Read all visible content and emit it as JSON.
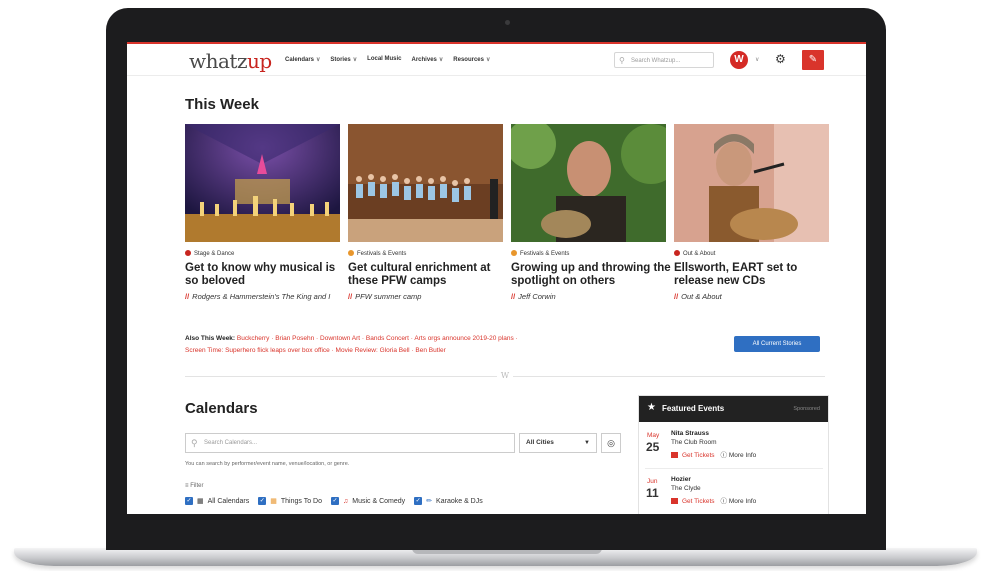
{
  "nav": {
    "logo_main": "whatz",
    "logo_accent": "up",
    "menu": [
      "Calendars",
      "Stories",
      "Local Music",
      "Archives",
      "Resources"
    ],
    "menu_has_chevron": [
      true,
      true,
      false,
      true,
      true
    ],
    "search_placeholder": "Search Whatzup...",
    "avatar_letter": "W"
  },
  "this_week": {
    "title": "This Week",
    "cards": [
      {
        "category": "Stage & Dance",
        "category_color": "#c8251f",
        "headline": "Get to know why musical is so beloved",
        "sub": "Rodgers & Hammerstein's The King and I"
      },
      {
        "category": "Festivals & Events",
        "category_color": "#e8962c",
        "headline": "Get cultural enrichment at these PFW camps",
        "sub": "PFW summer camp"
      },
      {
        "category": "Festivals & Events",
        "category_color": "#e8962c",
        "headline": "Growing up and throwing the spotlight on others",
        "sub": "Jeff Corwin"
      },
      {
        "category": "Out & About",
        "category_color": "#c8251f",
        "headline": "Ellsworth, EART set to release new CDs",
        "sub": "Out & About"
      }
    ],
    "also_label": "Also This Week:",
    "also_links": [
      "Buckcherry",
      "Brian Posehn",
      "Downtown Art",
      "Bands Concert",
      "Arts orgs announce 2019-20 plans",
      "Screen Time: Superhero flick leaps over box office",
      "Movie Review: Gloria Bell",
      "Ben Butler"
    ],
    "all_stories_button": "All Current Stories",
    "divider_mark": "W"
  },
  "calendars": {
    "title": "Calendars",
    "search_placeholder": "Search Calendars...",
    "city_select": "All Cities",
    "hint": "You can search by performer/event name, venue/location, or genre.",
    "filter_label": "Filter",
    "filters": [
      "All Calendars",
      "Things To Do",
      "Music & Comedy",
      "Karaoke & DJs"
    ]
  },
  "featured": {
    "title": "Featured Events",
    "sponsored": "Sponsored",
    "get_tickets": "Get Tickets",
    "more_info": "More Info",
    "events": [
      {
        "month": "May",
        "day": "25",
        "name": "Nita Strauss",
        "venue": "The Club Room"
      },
      {
        "month": "Jun",
        "day": "11",
        "name": "Hozier",
        "venue": "The Clyde"
      }
    ]
  }
}
